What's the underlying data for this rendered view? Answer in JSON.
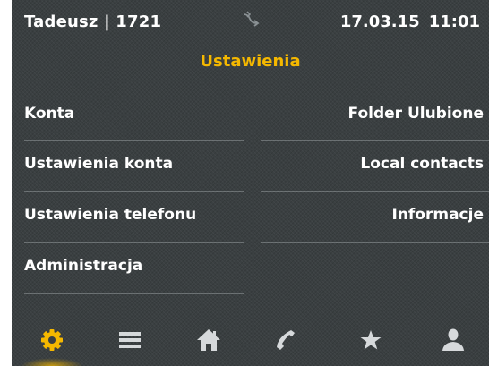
{
  "status": {
    "user": "Tadeusz | 1721",
    "date": "17.03.15",
    "time": "11:01"
  },
  "page_title": "Ustawienia",
  "menu": {
    "left": [
      {
        "label": "Konta"
      },
      {
        "label": "Ustawienia konta"
      },
      {
        "label": "Ustawienia telefonu"
      },
      {
        "label": "Administracja"
      }
    ],
    "right": [
      {
        "label": "Folder Ulubione"
      },
      {
        "label": "Local contacts"
      },
      {
        "label": "Informacje"
      }
    ]
  },
  "nav": [
    {
      "icon": "gear-icon",
      "active": true
    },
    {
      "icon": "menu-icon",
      "active": false
    },
    {
      "icon": "home-icon",
      "active": false
    },
    {
      "icon": "phone-icon",
      "active": false
    },
    {
      "icon": "star-icon",
      "active": false
    },
    {
      "icon": "person-icon",
      "active": false
    }
  ],
  "colors": {
    "accent": "#f5b800",
    "background": "#3a3f41",
    "text": "#ffffff",
    "icon": "#d6d9db"
  }
}
